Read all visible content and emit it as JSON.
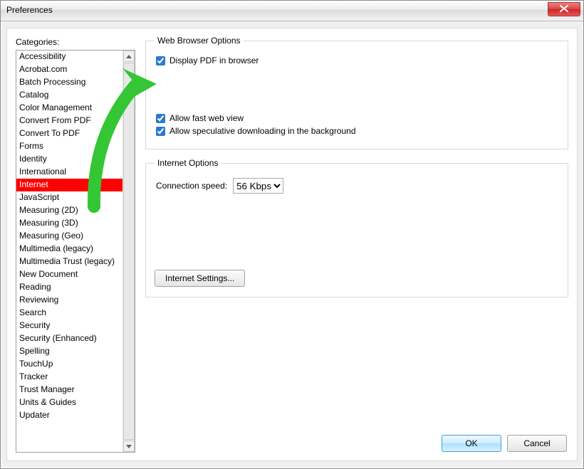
{
  "window": {
    "title": "Preferences"
  },
  "categories_label": "Categories:",
  "categories": [
    "Accessibility",
    "Acrobat.com",
    "Batch Processing",
    "Catalog",
    "Color Management",
    "Convert From PDF",
    "Convert To PDF",
    "Forms",
    "Identity",
    "International",
    "Internet",
    "JavaScript",
    "Measuring (2D)",
    "Measuring (3D)",
    "Measuring (Geo)",
    "Multimedia (legacy)",
    "Multimedia Trust (legacy)",
    "New Document",
    "Reading",
    "Reviewing",
    "Search",
    "Security",
    "Security (Enhanced)",
    "Spelling",
    "TouchUp",
    "Tracker",
    "Trust Manager",
    "Units & Guides",
    "Updater"
  ],
  "selected_category_index": 10,
  "group_web": {
    "legend": "Web Browser Options",
    "display_pdf": "Display PDF in browser",
    "fast_view": "Allow fast web view",
    "speculative": "Allow speculative downloading in the background"
  },
  "group_internet": {
    "legend": "Internet Options",
    "conn_label": "Connection speed:",
    "conn_value": "56 Kbps",
    "settings_btn": "Internet Settings..."
  },
  "buttons": {
    "ok": "OK",
    "cancel": "Cancel"
  }
}
